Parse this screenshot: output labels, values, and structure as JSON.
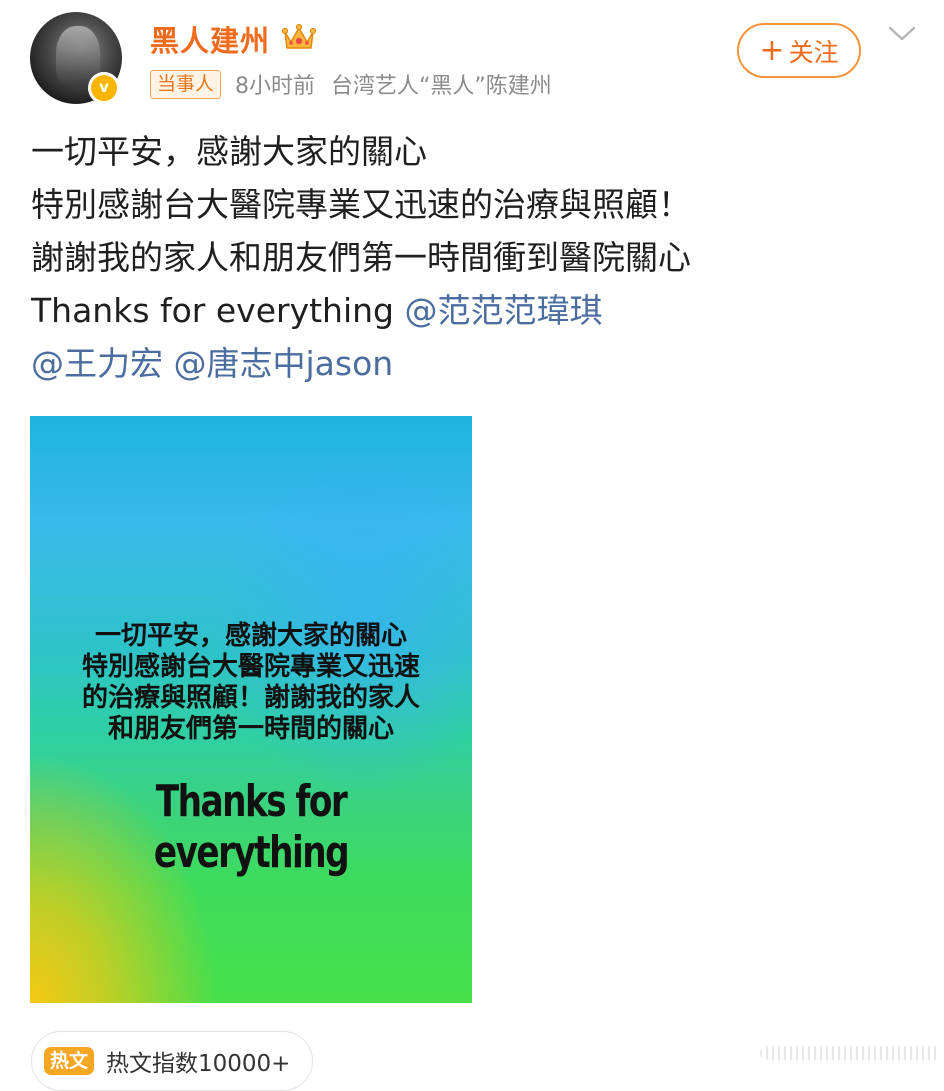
{
  "author": {
    "name": "黑人建州",
    "avatar_icon": "avatar-photo",
    "verified_icon": "verified-v-icon",
    "verified_letter": "v",
    "crown_icon": "crown-icon"
  },
  "meta": {
    "role_badge": "当事人",
    "time": "8小时前",
    "description": "台湾艺人“黑人”陈建州"
  },
  "actions": {
    "follow_plus": "+",
    "follow_label": "关注",
    "more_icon": "chevron-down-icon"
  },
  "post": {
    "lines": [
      "一切平安，感謝大家的關心",
      "特別感謝台大醫院專業又迅速的治療與照顧！",
      "謝謝我的家人和朋友們第一時間衝到醫院關心"
    ],
    "line4_text": "Thanks for everything ",
    "mentions": [
      "@范范范瑋琪",
      "@王力宏",
      "@唐志中jason"
    ]
  },
  "image": {
    "cn_lines": [
      "一切平安，感謝大家的關心",
      "特別感謝台大醫院專業又迅速",
      "的治療與照顧！謝謝我的家人",
      "和朋友們第一時間的關心"
    ],
    "en_text": "Thanks for everything"
  },
  "hot": {
    "icon_label": "热文",
    "label": "热文指数10000+"
  },
  "colors": {
    "username": "#f26b1d",
    "mention": "#4b6d9f",
    "follow_border": "#f5943b",
    "badge_bg": "#fff3e6",
    "hot_icon_bg": "#f5a623"
  }
}
